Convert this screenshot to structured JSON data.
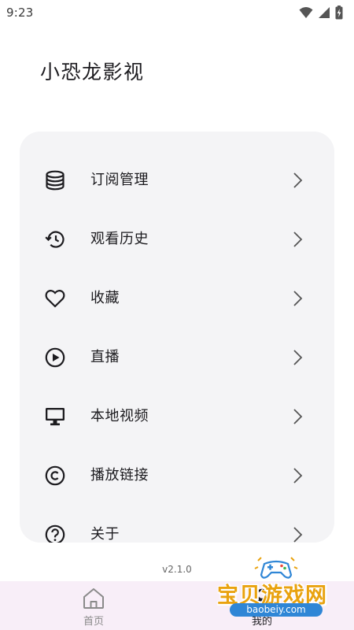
{
  "status_bar": {
    "time": "9:23"
  },
  "app_title": "小恐龙影视",
  "menu": {
    "items": [
      {
        "label": "订阅管理",
        "icon": "database-icon"
      },
      {
        "label": "观看历史",
        "icon": "history-icon"
      },
      {
        "label": "收藏",
        "icon": "heart-icon"
      },
      {
        "label": "直播",
        "icon": "play-circle-icon"
      },
      {
        "label": "本地视频",
        "icon": "monitor-icon"
      },
      {
        "label": "播放链接",
        "icon": "copyright-icon"
      },
      {
        "label": "关于",
        "icon": "help-circle-icon"
      }
    ]
  },
  "version": "v2.1.0",
  "bottom_nav": {
    "items": [
      {
        "label": "首页",
        "icon": "home-icon"
      },
      {
        "label": "我的",
        "icon": "person-icon"
      }
    ],
    "background": "#f8eef8"
  },
  "watermark": {
    "text": "宝贝游戏网",
    "url": "baobeiy.com"
  },
  "colors": {
    "card_background": "#f4f4f6",
    "text": "#1c1b1f",
    "watermark_orange": "#e9a20f",
    "watermark_blue": "#2f86d6"
  }
}
